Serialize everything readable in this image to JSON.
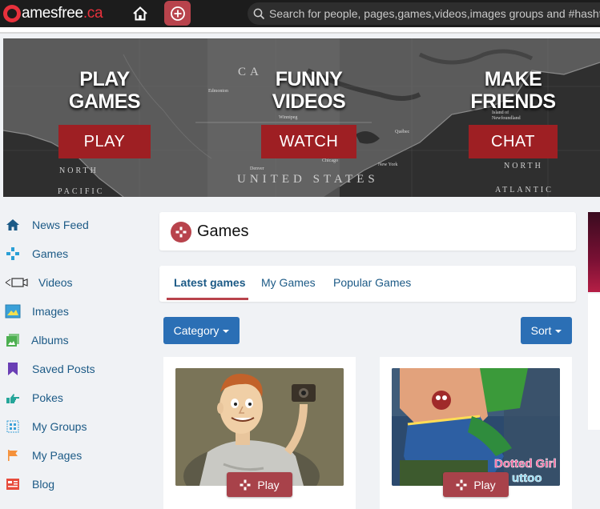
{
  "topbar": {
    "logo_g": "g",
    "logo_main": "amesfree",
    "logo_tld": ".ca",
    "search_placeholder": "Search for people, pages,games,videos,images groups and #hashtags"
  },
  "banner": {
    "ctas": [
      {
        "title_line1": "PLAY",
        "title_line2": "GAMES",
        "button": "PLAY"
      },
      {
        "title_line1": "FUNNY",
        "title_line2": "VIDEOS",
        "button": "WATCH"
      },
      {
        "title_line1": "MAKE",
        "title_line2": "FRIENDS",
        "button": "CHAT"
      }
    ],
    "map_labels": {
      "canada": "CA",
      "united_states": "UNITED STATES",
      "north_left": "NORTH",
      "pacific": "PACIFIC",
      "north_right": "NORTH",
      "atlantic": "ATLANTIC",
      "edmonton": "Edmonton",
      "winnipeg": "Winnipeg",
      "denver": "Denver",
      "chicago": "Chicago",
      "new_york": "New York",
      "quebec": "Québec",
      "island": "Island of Newfoundland"
    }
  },
  "sidebar": {
    "items": [
      {
        "label": "News Feed",
        "icon": "home-icon",
        "color": "#1c5a86"
      },
      {
        "label": "Games",
        "icon": "gamepad-icon",
        "color": "#2a9fd6"
      },
      {
        "label": "Videos",
        "icon": "video-camera-icon",
        "color": "#333333"
      },
      {
        "label": "Images",
        "icon": "image-icon",
        "color": "#3aa0d8"
      },
      {
        "label": "Albums",
        "icon": "albums-icon",
        "color": "#4caf50"
      },
      {
        "label": "Saved Posts",
        "icon": "bookmark-icon",
        "color": "#6a3fb5"
      },
      {
        "label": "Pokes",
        "icon": "poke-icon",
        "color": "#26a69a"
      },
      {
        "label": "My Groups",
        "icon": "groups-icon",
        "color": "#3aa0d8"
      },
      {
        "label": "My Pages",
        "icon": "flag-icon",
        "color": "#f5913a"
      },
      {
        "label": "Blog",
        "icon": "blog-icon",
        "color": "#e74c3c"
      }
    ]
  },
  "games": {
    "title": "Games",
    "tabs": [
      "Latest games",
      "My Games",
      "Popular Games"
    ],
    "category_label": "Category",
    "sort_label": "Sort",
    "play_label": "Play",
    "cards": [
      {
        "thumb": "cartoon-man-with-camera"
      },
      {
        "thumb": "dotted-girl-tattoo"
      }
    ],
    "card2_logo_line1": "Dotted Girl",
    "card2_logo_line2": "uttoo"
  },
  "colors": {
    "accent": "#b8434c",
    "link": "#1c5a86",
    "button_blue": "#2b6fb5",
    "banner_button": "#9e1f23"
  }
}
